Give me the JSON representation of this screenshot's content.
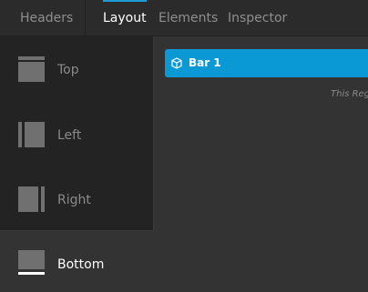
{
  "tabs": [
    {
      "label": "Headers",
      "active": false
    },
    {
      "label": "Layout",
      "active": true
    },
    {
      "label": "Elements",
      "active": false
    },
    {
      "label": "Inspector",
      "active": false
    }
  ],
  "dock_positions": [
    {
      "label": "Top",
      "icon": "dock-top-icon",
      "selected": false
    },
    {
      "label": "Left",
      "icon": "dock-left-icon",
      "selected": false
    },
    {
      "label": "Right",
      "icon": "dock-right-icon",
      "selected": false
    },
    {
      "label": "Bottom",
      "icon": "dock-bottom-icon",
      "selected": true
    }
  ],
  "content": {
    "bar_label": "Bar 1",
    "bar_icon": "cube-icon",
    "hint_text": "This Reg"
  },
  "colors": {
    "accent": "#0b99d6",
    "background": "#333333",
    "panel": "#232323",
    "tabbar": "#2b2b2b"
  }
}
